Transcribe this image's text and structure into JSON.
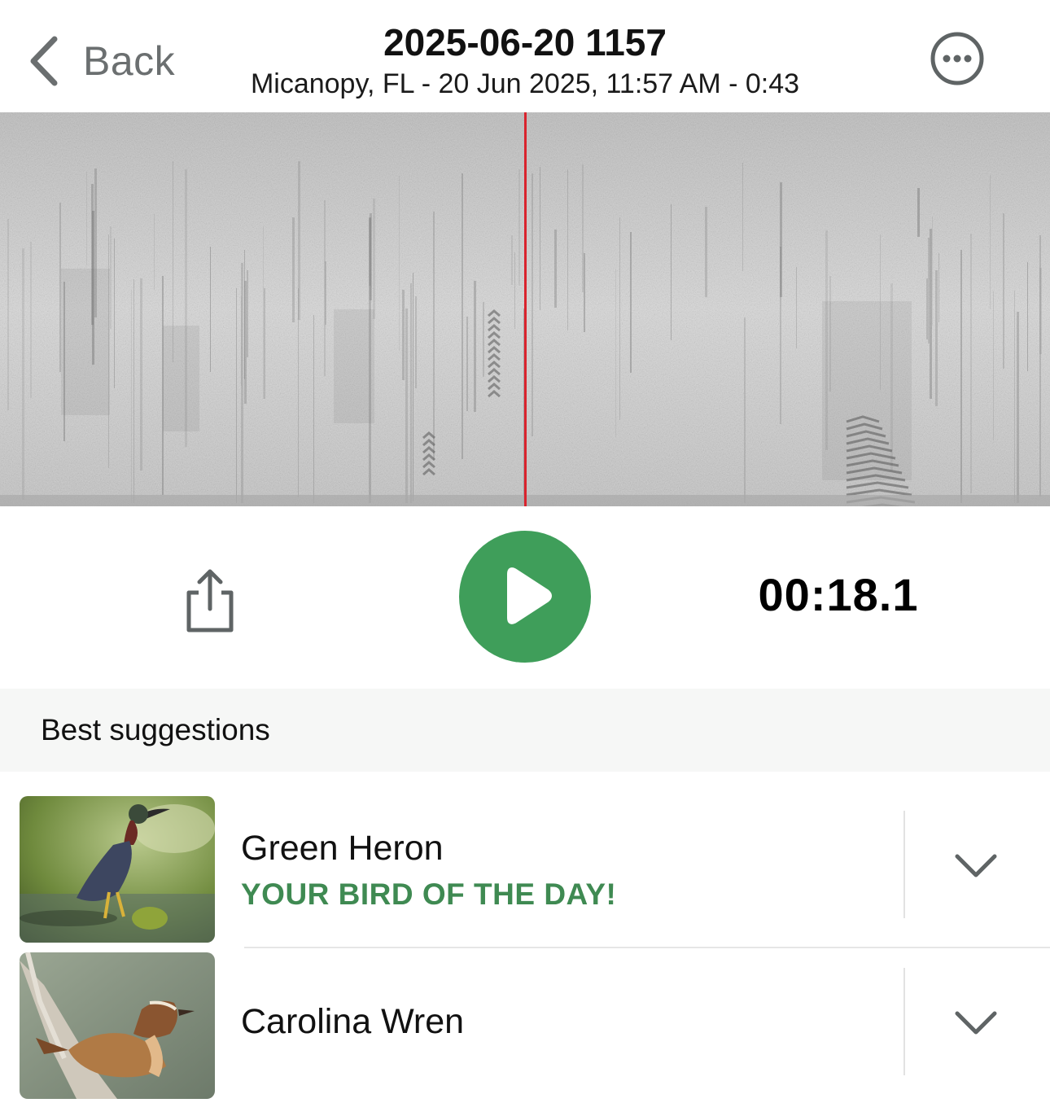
{
  "header": {
    "back_label": "Back",
    "title": "2025-06-20 1157",
    "subtitle": "Micanopy, FL - 20 Jun 2025, 11:57 AM - 0:43"
  },
  "player": {
    "timer": "00:18.1",
    "accent_color": "#3f9e5a",
    "playhead_color": "#d9232d"
  },
  "suggestions": {
    "section_label": "Best suggestions",
    "items": [
      {
        "name": "Green Heron",
        "tagline": "YOUR BIRD OF THE DAY!",
        "thumbnail": "green-heron-photo"
      },
      {
        "name": "Carolina Wren",
        "thumbnail": "carolina-wren-photo"
      }
    ]
  },
  "icons": {
    "back": "chevron-left-icon",
    "more": "ellipsis-circle-icon",
    "share": "share-icon",
    "play": "play-icon",
    "expand": "chevron-down-icon"
  }
}
